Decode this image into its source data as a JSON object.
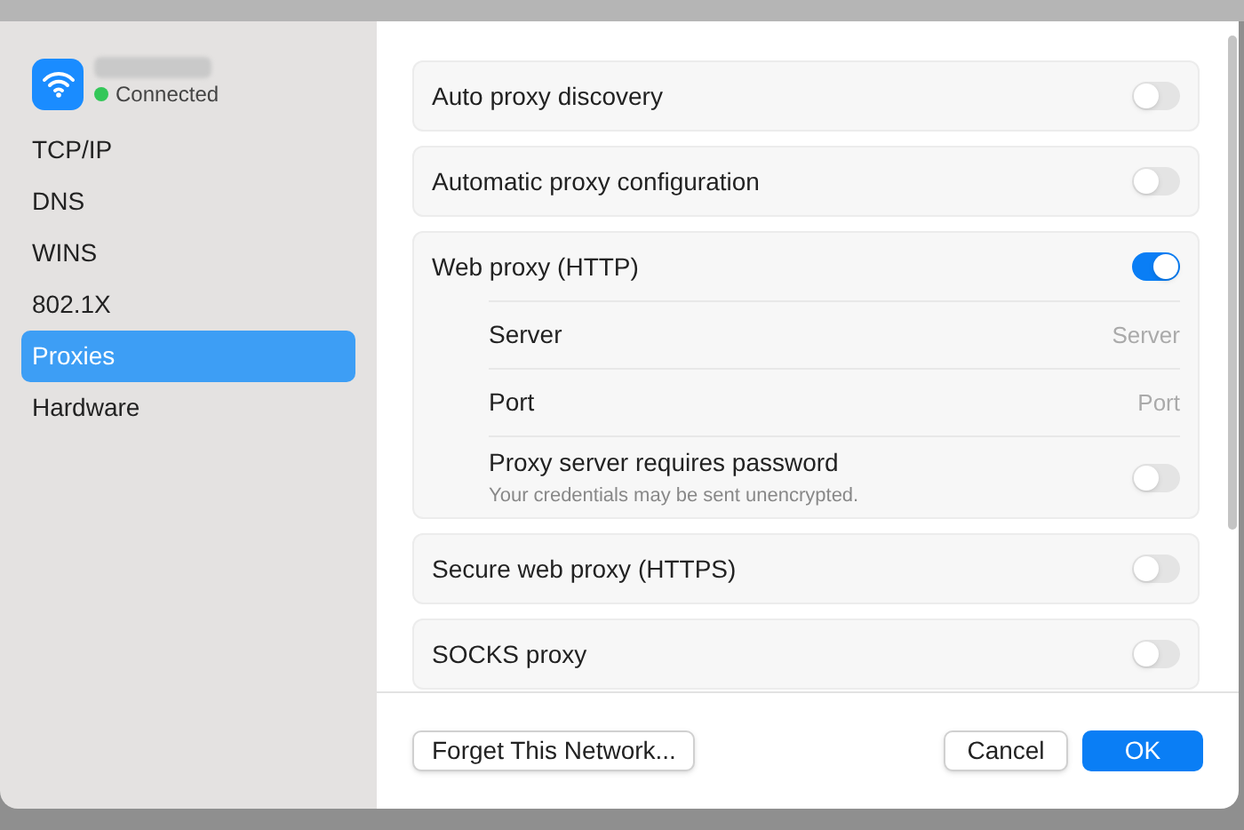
{
  "network": {
    "status": "Connected"
  },
  "sidebar": {
    "items": [
      {
        "label": "TCP/IP",
        "selected": false
      },
      {
        "label": "DNS",
        "selected": false
      },
      {
        "label": "WINS",
        "selected": false
      },
      {
        "label": "802.1X",
        "selected": false
      },
      {
        "label": "Proxies",
        "selected": true
      },
      {
        "label": "Hardware",
        "selected": false
      }
    ]
  },
  "groups": [
    {
      "rows": [
        {
          "kind": "toggle",
          "label": "Auto proxy discovery",
          "on": false
        }
      ]
    },
    {
      "rows": [
        {
          "kind": "toggle",
          "label": "Automatic proxy configuration",
          "on": false
        }
      ]
    },
    {
      "rows": [
        {
          "kind": "toggle",
          "label": "Web proxy (HTTP)",
          "on": true
        },
        {
          "kind": "field",
          "label": "Server",
          "placeholder": "Server"
        },
        {
          "kind": "field",
          "label": "Port",
          "placeholder": "Port"
        },
        {
          "kind": "toggle",
          "label": "Proxy server requires password",
          "note": "Your credentials may be sent unencrypted.",
          "on": false
        }
      ]
    },
    {
      "rows": [
        {
          "kind": "toggle",
          "label": "Secure web proxy (HTTPS)",
          "on": false
        }
      ]
    },
    {
      "rows": [
        {
          "kind": "toggle",
          "label": "SOCKS proxy",
          "on": false
        }
      ]
    }
  ],
  "buttons": {
    "forget": "Forget This Network...",
    "cancel": "Cancel",
    "ok": "OK"
  }
}
